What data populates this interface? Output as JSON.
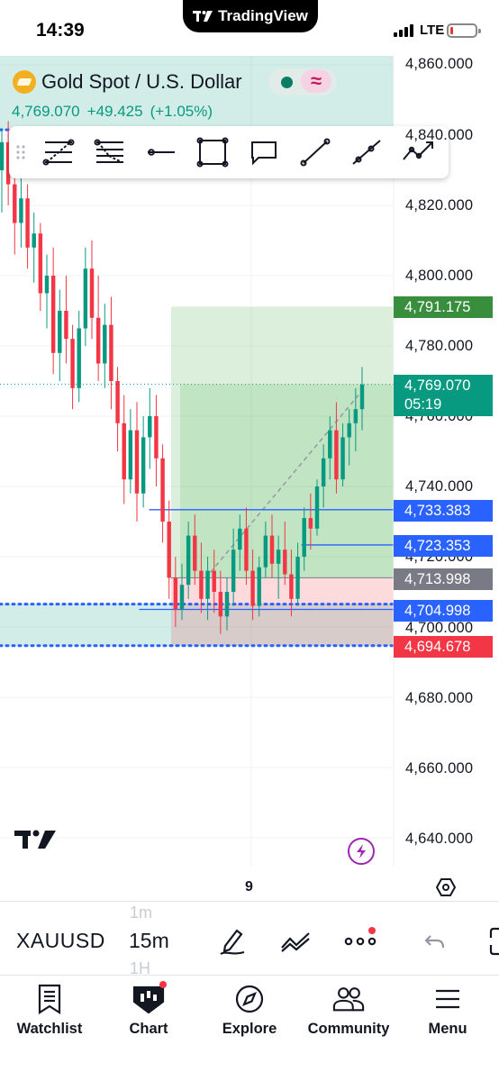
{
  "status_bar": {
    "time": "14:39",
    "app_banner": "TradingView",
    "network": "LTE",
    "battery_level": 0.12
  },
  "symbol": {
    "title": "Gold Spot / U.S. Dollar",
    "last": "4,769.070",
    "change": "+49.425",
    "change_pct": "(+1.05%)",
    "market_state_color": "#0a7d63",
    "delayed_glyph": "≈",
    "icon": "gold-bars-icon"
  },
  "drawing_toolbar": {
    "tools": [
      "drag-grip-icon",
      "fib-retracement-icon",
      "fib-extension-icon",
      "horizontal-line-icon",
      "rectangle-icon",
      "callout-icon",
      "trend-line-icon",
      "ray-icon",
      "path-icon"
    ]
  },
  "price_axis": {
    "labels": [
      "4,860.000",
      "4,840.000",
      "4,820.000",
      "4,800.000",
      "4,780.000",
      "4,760.000",
      "4,740.000",
      "4,720.000",
      "4,700.000",
      "4,680.000",
      "4,660.000",
      "4,640.000"
    ],
    "current_price": "4,769.070",
    "countdown": "05:19",
    "markers": [
      {
        "value": "4,791.175",
        "color": "#388e3c"
      },
      {
        "value": "4,733.383",
        "color": "#2962ff"
      },
      {
        "value": "4,723.353",
        "color": "#2962ff"
      },
      {
        "value": "4,713.998",
        "color": "#787b86"
      },
      {
        "value": "4,704.998",
        "color": "#2962ff"
      },
      {
        "value": "4,694.678",
        "color": "#f23645"
      }
    ]
  },
  "time_axis": {
    "label": "9"
  },
  "controls": {
    "ticker": "XAUUSD",
    "timeframe": "15m",
    "timeframe_above": "1m",
    "timeframe_below": "1H"
  },
  "bottom_nav": [
    {
      "label": "Watchlist",
      "icon": "watchlist-icon"
    },
    {
      "label": "Chart",
      "icon": "chart-icon"
    },
    {
      "label": "Explore",
      "icon": "compass-icon"
    },
    {
      "label": "Community",
      "icon": "community-icon"
    },
    {
      "label": "Menu",
      "icon": "hamburger-icon"
    }
  ],
  "chart_data": {
    "type": "candlestick",
    "symbol": "XAUUSD",
    "interval": "15m",
    "ylim": [
      4630,
      4868
    ],
    "bull_color": "#089981",
    "bear_color": "#f23645",
    "price_line": 4769.07,
    "position": {
      "side": "long",
      "entry": 4713.998,
      "target": 4791.175,
      "stop": 4694.678
    },
    "levels": [
      {
        "price": 4733.383,
        "style": "solid",
        "color": "#2962ff"
      },
      {
        "price": 4723.353,
        "style": "solid",
        "color": "#2962ff"
      },
      {
        "price": 4704.998,
        "style": "solid",
        "color": "#2962ff"
      },
      {
        "price": 4706.5,
        "style": "dotted",
        "color": "#2962ff"
      },
      {
        "price": 4694.678,
        "style": "dotted",
        "color": "#2962ff"
      },
      {
        "price": 4841.5,
        "style": "dotted",
        "color": "#2962ff"
      }
    ],
    "zones": [
      {
        "from": 4694.678,
        "to": 4706.5,
        "color": "#089981"
      },
      {
        "from": 4841.5,
        "to": 4868,
        "color": "#089981"
      }
    ],
    "candles": [
      [
        4830,
        4842,
        4818,
        4838
      ],
      [
        4838,
        4844,
        4820,
        4826
      ],
      [
        4826,
        4832,
        4806,
        4815
      ],
      [
        4815,
        4828,
        4808,
        4822
      ],
      [
        4822,
        4826,
        4802,
        4808
      ],
      [
        4808,
        4818,
        4798,
        4812
      ],
      [
        4812,
        4815,
        4790,
        4795
      ],
      [
        4795,
        4806,
        4785,
        4800
      ],
      [
        4800,
        4808,
        4772,
        4778
      ],
      [
        4778,
        4796,
        4770,
        4790
      ],
      [
        4790,
        4800,
        4775,
        4782
      ],
      [
        4782,
        4786,
        4762,
        4768
      ],
      [
        4768,
        4790,
        4764,
        4785
      ],
      [
        4785,
        4808,
        4780,
        4802
      ],
      [
        4802,
        4810,
        4782,
        4788
      ],
      [
        4788,
        4800,
        4770,
        4775
      ],
      [
        4775,
        4792,
        4768,
        4786
      ],
      [
        4786,
        4794,
        4762,
        4770
      ],
      [
        4770,
        4774,
        4750,
        4758
      ],
      [
        4758,
        4766,
        4735,
        4742
      ],
      [
        4742,
        4762,
        4738,
        4756
      ],
      [
        4756,
        4764,
        4730,
        4738
      ],
      [
        4738,
        4760,
        4734,
        4754
      ],
      [
        4754,
        4768,
        4745,
        4760
      ],
      [
        4760,
        4766,
        4740,
        4748
      ],
      [
        4748,
        4752,
        4724,
        4730
      ],
      [
        4730,
        4736,
        4708,
        4714
      ],
      [
        4714,
        4720,
        4700,
        4705
      ],
      [
        4705,
        4718,
        4702,
        4712
      ],
      [
        4712,
        4730,
        4708,
        4726
      ],
      [
        4726,
        4732,
        4712,
        4716
      ],
      [
        4716,
        4724,
        4704,
        4708
      ],
      [
        4708,
        4720,
        4702,
        4716
      ],
      [
        4716,
        4722,
        4704,
        4710
      ],
      [
        4710,
        4716,
        4698,
        4703
      ],
      [
        4703,
        4714,
        4699,
        4710
      ],
      [
        4710,
        4728,
        4706,
        4722
      ],
      [
        4722,
        4732,
        4716,
        4728
      ],
      [
        4728,
        4734,
        4712,
        4716
      ],
      [
        4716,
        4722,
        4702,
        4706
      ],
      [
        4706,
        4720,
        4703,
        4717
      ],
      [
        4717,
        4730,
        4714,
        4726
      ],
      [
        4726,
        4732,
        4714,
        4718
      ],
      [
        4718,
        4726,
        4708,
        4722
      ],
      [
        4722,
        4730,
        4712,
        4715
      ],
      [
        4715,
        4722,
        4703,
        4708
      ],
      [
        4708,
        4724,
        4706,
        4720
      ],
      [
        4720,
        4734,
        4716,
        4731
      ],
      [
        4731,
        4738,
        4722,
        4728
      ],
      [
        4728,
        4742,
        4726,
        4740
      ],
      [
        4740,
        4752,
        4734,
        4748
      ],
      [
        4748,
        4760,
        4742,
        4756
      ],
      [
        4756,
        4764,
        4738,
        4742
      ],
      [
        4742,
        4758,
        4740,
        4754
      ],
      [
        4754,
        4762,
        4746,
        4758
      ],
      [
        4758,
        4768,
        4750,
        4762
      ],
      [
        4762,
        4774,
        4756,
        4769
      ]
    ]
  }
}
